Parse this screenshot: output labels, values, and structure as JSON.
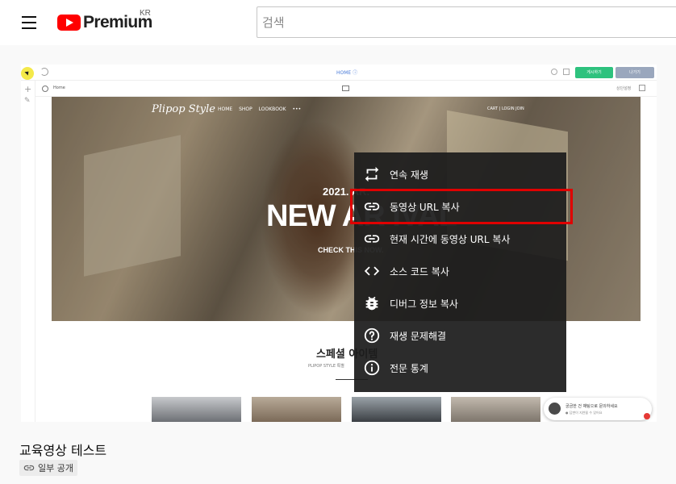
{
  "header": {
    "logo_text": "Premium",
    "logo_region": "KR",
    "search_placeholder": "검색"
  },
  "player": {
    "builder": {
      "home_label": "HOME ⓘ",
      "save_label": "게시하기",
      "exit_label": "나가기",
      "tab_home": "Home",
      "tab_right": "상단설정"
    },
    "site": {
      "logo": "Plipop Style",
      "nav": "HOME SHOP LOOKBOOK •••",
      "nav_right": "CART | LOGIN JOIN",
      "hero_date": "2021. AR.",
      "hero_title": "NEW AR IVAL",
      "hero_sub": "CHECK THIS NOW.",
      "section_title": "스페셜 아이템",
      "section_sub": "PLIPOP STYLE 특별"
    },
    "chat": {
      "text": "궁금한 건 채팅으로 문의하세요",
      "subtext": "● 답변이 지연될 수 있어요"
    }
  },
  "context_menu": {
    "items": [
      {
        "icon": "loop-icon",
        "label": "연속 재생"
      },
      {
        "icon": "link-icon",
        "label": "동영상 URL 복사",
        "highlighted": true
      },
      {
        "icon": "link-icon",
        "label": "현재 시간에 동영상 URL 복사"
      },
      {
        "icon": "code-icon",
        "label": "소스 코드 복사"
      },
      {
        "icon": "bug-icon",
        "label": "디버그 정보 복사"
      },
      {
        "icon": "help-icon",
        "label": "재생 문제해결"
      },
      {
        "icon": "info-icon",
        "label": "전문 통계"
      }
    ],
    "highlight_color": "#e00000"
  },
  "video": {
    "title": "교육영상 테스트",
    "visibility": "일부 공개"
  },
  "colors": {
    "brand_red": "#ff0000",
    "page_bg": "#f9f9f9"
  }
}
